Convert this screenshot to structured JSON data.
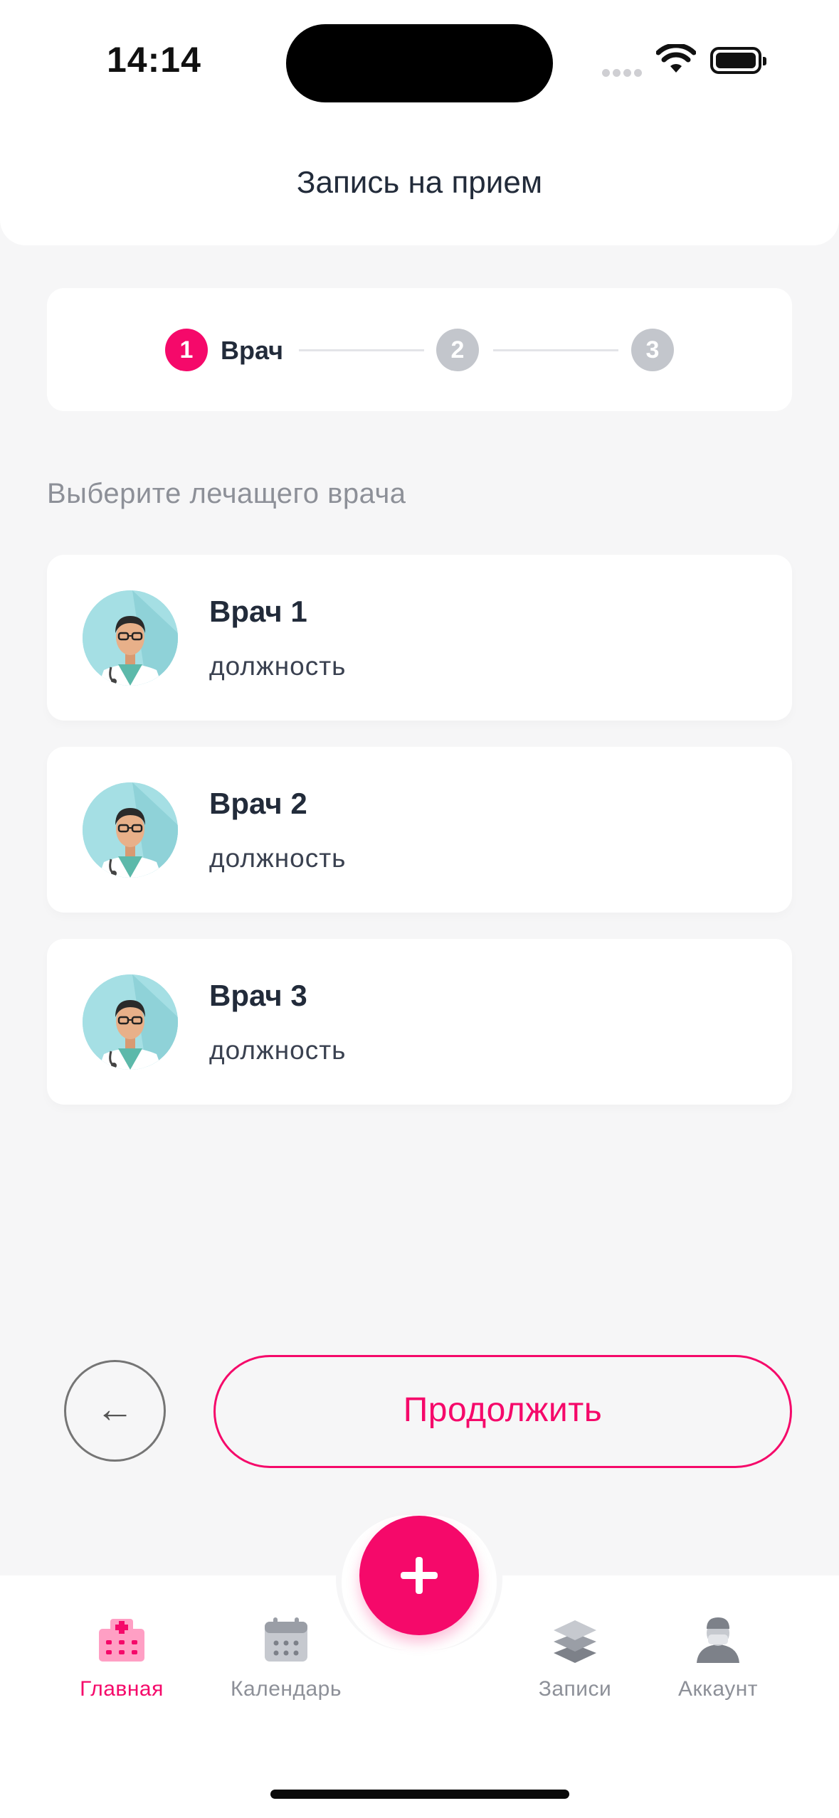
{
  "status_bar": {
    "time": "14:14"
  },
  "header": {
    "title": "Запись на прием"
  },
  "stepper": {
    "steps": [
      {
        "number": "1",
        "label": "Врач",
        "active": true
      },
      {
        "number": "2",
        "label": "",
        "active": false
      },
      {
        "number": "3",
        "label": "",
        "active": false
      }
    ]
  },
  "section_label": "Выберите лечащего врача",
  "doctors": [
    {
      "name": "Врач 1",
      "position": "должность"
    },
    {
      "name": "Врач 2",
      "position": "должность"
    },
    {
      "name": "Врач 3",
      "position": "должность"
    }
  ],
  "actions": {
    "back_symbol": "←",
    "continue_label": "Продолжить"
  },
  "tabbar": {
    "items": [
      {
        "label": "Главная",
        "icon": "hospital-icon",
        "active": true
      },
      {
        "label": "Календарь",
        "icon": "calendar-icon",
        "active": false
      },
      {
        "label": "Записи",
        "icon": "layers-icon",
        "active": false
      },
      {
        "label": "Аккаунт",
        "icon": "doctor-account-icon",
        "active": false
      }
    ],
    "fab_icon": "plus-icon"
  },
  "colors": {
    "accent": "#f5096a",
    "inactive_step": "#c3c6cc",
    "text": "#222b3a",
    "muted": "#8d9098",
    "background": "#f6f6f7"
  }
}
